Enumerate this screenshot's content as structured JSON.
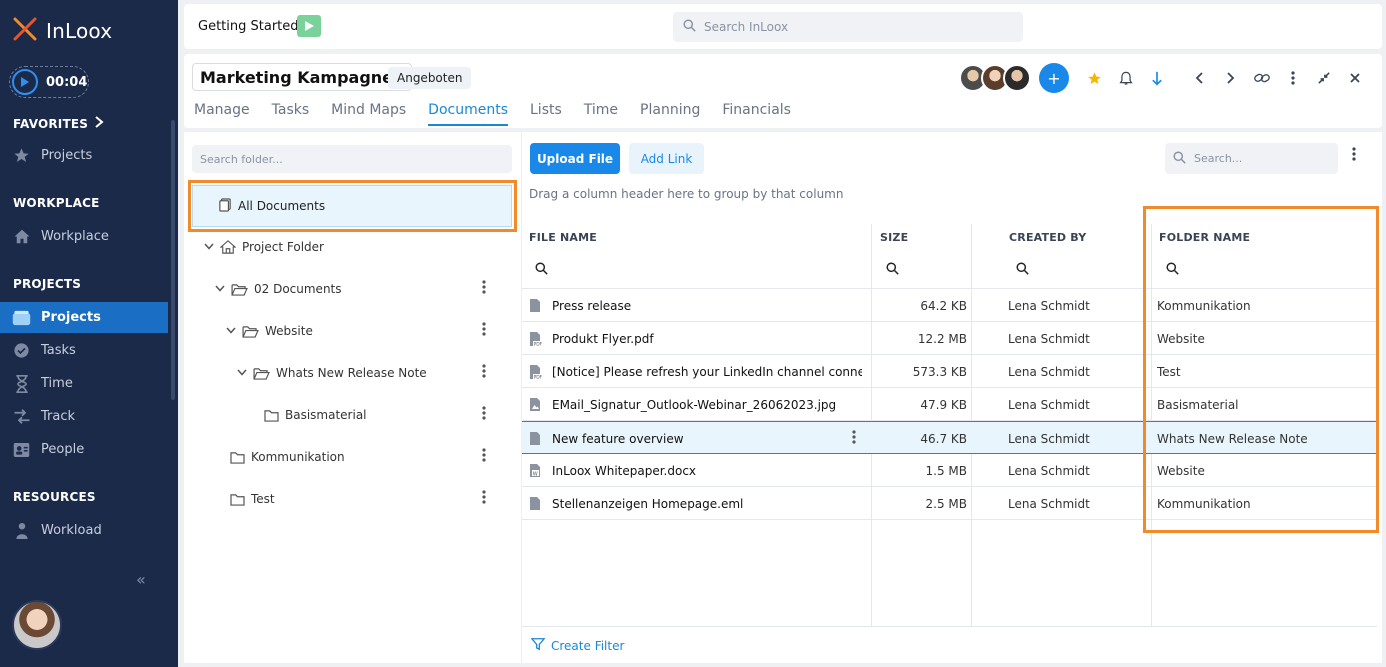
{
  "app": {
    "name": "InLoox"
  },
  "timer": {
    "value": "00:04"
  },
  "sidebar": {
    "favorites_label": "FAVORITES",
    "favorites_items": [
      {
        "label": "Projects",
        "icon": "star-icon"
      }
    ],
    "workplace_label": "WORKPLACE",
    "workplace_items": [
      {
        "label": "Workplace",
        "icon": "home-icon"
      }
    ],
    "projects_label": "PROJECTS",
    "projects_items": [
      {
        "label": "Projects",
        "icon": "projects-icon",
        "active": true
      },
      {
        "label": "Tasks",
        "icon": "check-circle-icon"
      },
      {
        "label": "Time",
        "icon": "hourglass-icon"
      },
      {
        "label": "Track",
        "icon": "track-icon"
      },
      {
        "label": "People",
        "icon": "contact-card-icon"
      }
    ],
    "resources_label": "RESOURCES",
    "resources_items": [
      {
        "label": "Workload",
        "icon": "workload-icon"
      }
    ],
    "collapse_glyph": "«"
  },
  "topbar": {
    "getting_started": "Getting Started:",
    "search_placeholder": "Search InLoox"
  },
  "project": {
    "title": "Marketing Kampagnen",
    "status": "Angeboten",
    "tabs": [
      "Manage",
      "Tasks",
      "Mind Maps",
      "Documents",
      "Lists",
      "Time",
      "Planning",
      "Financials"
    ],
    "active_tab": "Documents",
    "add_glyph": "+"
  },
  "folders": {
    "search_placeholder": "Search folder...",
    "all_documents": "All Documents",
    "tree": [
      {
        "label": "Project Folder",
        "level": 0,
        "expanded": true,
        "type": "home"
      },
      {
        "label": "02 Documents",
        "level": 1,
        "expanded": true,
        "type": "folder-open"
      },
      {
        "label": "Website",
        "level": 2,
        "expanded": true,
        "type": "folder-open"
      },
      {
        "label": "Whats New Release Note",
        "level": 3,
        "expanded": true,
        "type": "folder-open"
      },
      {
        "label": "Basismaterial",
        "level": 4,
        "expanded": false,
        "type": "folder"
      },
      {
        "label": "Kommunikation",
        "level": 1,
        "expanded": false,
        "type": "folder"
      },
      {
        "label": "Test",
        "level": 1,
        "expanded": false,
        "type": "folder"
      }
    ]
  },
  "documents": {
    "upload_label": "Upload File",
    "add_link_label": "Add Link",
    "search_placeholder": "Search...",
    "group_hint": "Drag a column header here to group by that column",
    "columns": {
      "name": "FILE NAME",
      "size": "SIZE",
      "created_by": "CREATED BY",
      "folder": "FOLDER NAME"
    },
    "rows": [
      {
        "name": "Press release",
        "size": "64.2 KB",
        "created_by": "Lena Schmidt",
        "folder": "Kommunikation",
        "icon": "file-icon"
      },
      {
        "name": "Produkt Flyer.pdf",
        "size": "12.2 MB",
        "created_by": "Lena Schmidt",
        "folder": "Website",
        "icon": "pdf-file-icon"
      },
      {
        "name": "[Notice] Please refresh your LinkedIn channel conne…",
        "size": "573.3 KB",
        "created_by": "Lena Schmidt",
        "folder": "Test",
        "icon": "pdf-file-icon"
      },
      {
        "name": "EMail_Signatur_Outlook-Webinar_26062023.jpg",
        "size": "47.9 KB",
        "created_by": "Lena Schmidt",
        "folder": "Basismaterial",
        "icon": "image-file-icon"
      },
      {
        "name": "New feature overview",
        "size": "46.7 KB",
        "created_by": "Lena Schmidt",
        "folder": "Whats New Release Note",
        "icon": "file-icon",
        "selected": true
      },
      {
        "name": "InLoox Whitepaper.docx",
        "size": "1.5 MB",
        "created_by": "Lena Schmidt",
        "folder": "Website",
        "icon": "word-file-icon"
      },
      {
        "name": "Stellenanzeigen Homepage.eml",
        "size": "2.5 MB",
        "created_by": "Lena Schmidt",
        "folder": "Kommunikation",
        "icon": "file-icon"
      }
    ],
    "create_filter": "Create Filter"
  },
  "colors": {
    "sidebar_bg": "#1c2a4a",
    "accent": "#1a88e8",
    "highlight": "#f08a2b",
    "selected_row": "#e8f5fc"
  }
}
